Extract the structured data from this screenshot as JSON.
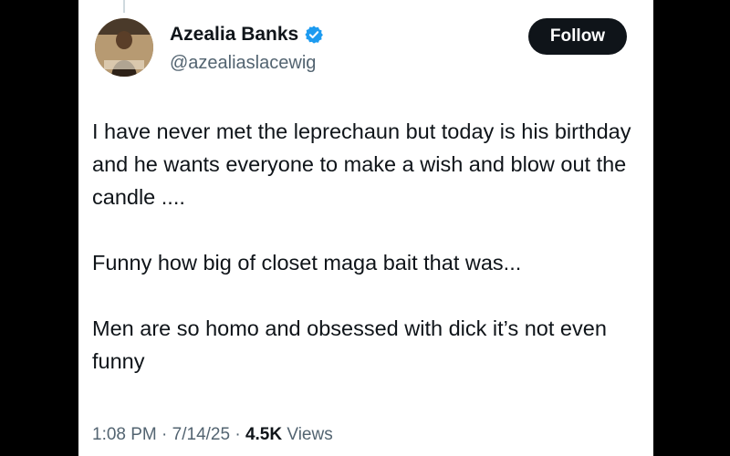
{
  "author": {
    "display_name": "Azealia Banks",
    "handle": "@azealiaslacewig",
    "verified": true
  },
  "follow_button": {
    "label": "Follow"
  },
  "tweet": {
    "paragraphs": [
      "I have never met the leprechaun but today is his birthday and he wants everyone to make a wish and blow out the candle ....",
      "Funny how big of closet maga bait that was...",
      "Men are so homo and obsessed with dick it’s not even funny"
    ]
  },
  "meta": {
    "time": "1:08 PM",
    "date": "7/14/25",
    "views_count": "4.5K",
    "views_label": "Views",
    "separator": "·"
  },
  "colors": {
    "background": "#ffffff",
    "page_frame": "#000000",
    "primary_text": "#0f1419",
    "secondary_text": "#536471",
    "verified_badge": "#1d9bf0",
    "follow_button_bg": "#0f1419"
  },
  "icons": {
    "verified": "verified-badge-icon"
  }
}
